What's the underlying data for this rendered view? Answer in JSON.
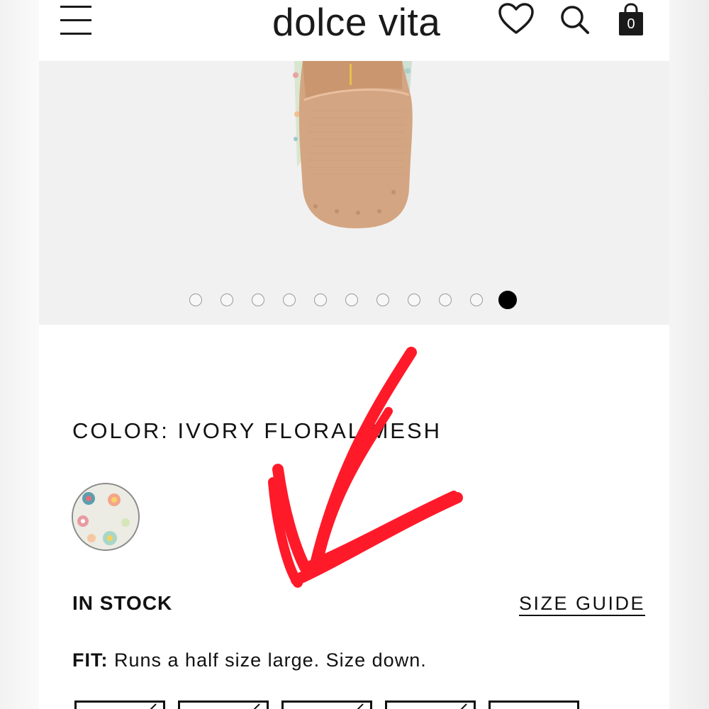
{
  "header": {
    "logo": "dolce vita",
    "cart_count": "0",
    "menu_icon": "hamburger-menu-icon",
    "wishlist_icon": "heart-icon",
    "search_icon": "search-icon",
    "cart_icon": "shopping-bag-icon"
  },
  "gallery": {
    "image_count": 11,
    "active_index": 10
  },
  "product": {
    "color_line": "COLOR: IVORY FLORAL MESH",
    "stock_status": "IN STOCK",
    "size_guide_label": "SIZE GUIDE",
    "fit_label": "FIT:",
    "fit_text": " Runs a half size large. Size down.",
    "size_option_count": 5,
    "unavailable_sizes": 4
  },
  "colors": {
    "accent": "#111111",
    "annotation": "#ff1a2a",
    "gallery_bg": "#f1f1f1",
    "sole": "#d4a582"
  }
}
